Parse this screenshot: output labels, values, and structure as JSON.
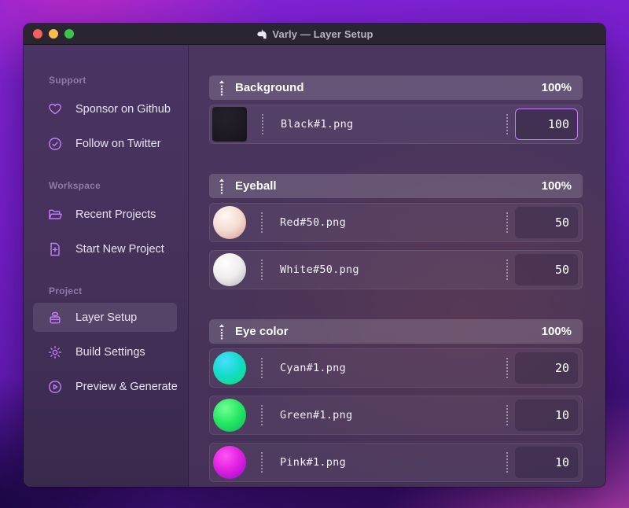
{
  "window": {
    "title": "Varly — Layer Setup",
    "title_icon": "unicorn",
    "traffic_lights": [
      "close",
      "minimize",
      "zoom"
    ]
  },
  "sidebar": {
    "sections": [
      {
        "label": "Support",
        "items": [
          {
            "icon": "heart",
            "label": "Sponsor on Github",
            "active": false
          },
          {
            "icon": "badge-check",
            "label": "Follow on Twitter",
            "active": false
          }
        ]
      },
      {
        "label": "Workspace",
        "items": [
          {
            "icon": "folder",
            "label": "Recent Projects",
            "active": false
          },
          {
            "icon": "file-plus",
            "label": "Start New Project",
            "active": false
          }
        ]
      },
      {
        "label": "Project",
        "items": [
          {
            "icon": "layers",
            "label": "Layer Setup",
            "active": true
          },
          {
            "icon": "gear",
            "label": "Build Settings",
            "active": false
          },
          {
            "icon": "play-circle",
            "label": "Preview & Generate",
            "active": false
          }
        ]
      }
    ]
  },
  "main": {
    "groups": [
      {
        "name": "Background",
        "weight": "100%",
        "layers": [
          {
            "file": "Black#1.png",
            "value": "100",
            "focused": true,
            "thumb_shape": "square",
            "thumb_colors": [
              "#262029",
              "#1f1a23",
              "#18141c"
            ]
          }
        ]
      },
      {
        "name": "Eyeball",
        "weight": "100%",
        "layers": [
          {
            "file": "Red#50.png",
            "value": "50",
            "focused": false,
            "thumb_shape": "circle",
            "thumb_colors": [
              "#fff8f3",
              "#f4dcd2",
              "#d9a394"
            ]
          },
          {
            "file": "White#50.png",
            "value": "50",
            "focused": false,
            "thumb_shape": "circle",
            "thumb_colors": [
              "#ffffff",
              "#f0edef",
              "#c2bbc0"
            ]
          }
        ]
      },
      {
        "name": "Eye color",
        "weight": "100%",
        "layers": [
          {
            "file": "Cyan#1.png",
            "value": "20",
            "focused": false,
            "thumb_shape": "circle",
            "thumb_colors": [
              "#49ddff",
              "#12ddc8",
              "#10dd7d"
            ]
          },
          {
            "file": "Green#1.png",
            "value": "10",
            "focused": false,
            "thumb_shape": "circle",
            "thumb_colors": [
              "#72ff93",
              "#25e863",
              "#0fbe62"
            ]
          },
          {
            "file": "Pink#1.png",
            "value": "10",
            "focused": false,
            "thumb_shape": "circle",
            "thumb_colors": [
              "#ff55f2",
              "#e120e0",
              "#9b12c9"
            ]
          }
        ]
      }
    ]
  },
  "colors": {
    "accent": "#c77dfa",
    "icon": "#c07ef5",
    "group_header_text": "#ffffff",
    "sidebar_section_label": "#8f7ba8",
    "titlebar_bg": "#2b2531"
  }
}
